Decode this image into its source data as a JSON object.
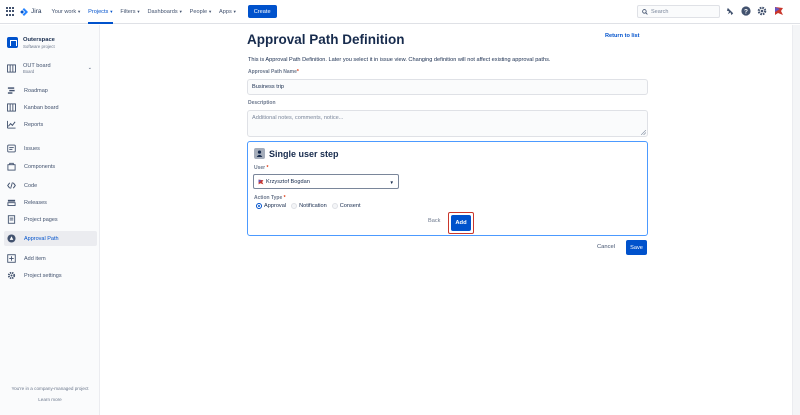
{
  "app": {
    "name": "Jira"
  },
  "topnav": {
    "items": [
      {
        "label": "Your work"
      },
      {
        "label": "Projects"
      },
      {
        "label": "Filters"
      },
      {
        "label": "Dashboards"
      },
      {
        "label": "People"
      },
      {
        "label": "Apps"
      }
    ],
    "create_label": "Create",
    "search_placeholder": "Search",
    "accent": "#0052cc"
  },
  "sidebar": {
    "project_name": "Outerspace",
    "project_type": "Software project",
    "board_title": "OUT board",
    "board_sub": "Board",
    "items": [
      {
        "label": "Roadmap",
        "icon": "roadmap-icon"
      },
      {
        "label": "Kanban board",
        "icon": "board-icon"
      },
      {
        "label": "Reports",
        "icon": "reports-icon"
      },
      {
        "label": "Issues",
        "icon": "issues-icon"
      },
      {
        "label": "Components",
        "icon": "components-icon"
      },
      {
        "label": "Code",
        "icon": "code-icon"
      },
      {
        "label": "Releases",
        "icon": "releases-icon"
      },
      {
        "label": "Project pages",
        "icon": "pages-icon"
      },
      {
        "label": "Approval Path",
        "icon": "approval-path-icon",
        "active": true
      },
      {
        "label": "Add item",
        "icon": "add-item-icon"
      },
      {
        "label": "Project settings",
        "icon": "settings-icon"
      }
    ],
    "footer_text": "You're in a company-managed project",
    "footer_link": "Learn more"
  },
  "main": {
    "title": "Approval Path Definition",
    "return_link": "Return to list",
    "intro": "This is Approval Path Definition. Later you select it in issue view. Changing definition will not affect existing approval paths.",
    "name_label": "Approval Path Name",
    "name_value": "Business trip",
    "description_label": "Description",
    "description_placeholder": "Additional notes, comments, notice...",
    "step": {
      "title": "Single user step",
      "user_label": "User",
      "user_value": "Krzysztof Bogdan",
      "action_label": "Action Type",
      "options": [
        {
          "label": "Approval",
          "checked": true
        },
        {
          "label": "Notification",
          "checked": false
        },
        {
          "label": "Consent",
          "checked": false
        }
      ],
      "back_label": "Back",
      "add_label": "Add"
    },
    "cancel_label": "Cancel",
    "save_label": "Save"
  }
}
